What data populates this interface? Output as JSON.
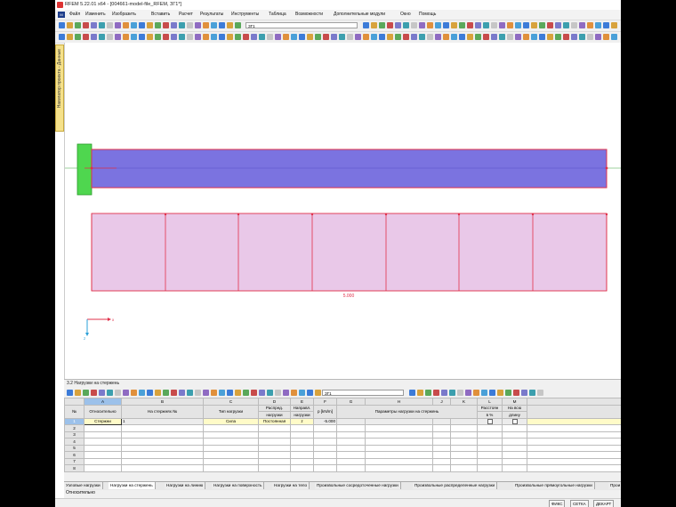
{
  "window": {
    "title": "RFEM 5.22.01 x64 - [004661-model-file_RFEM, ЗГ1*]"
  },
  "menu": [
    "Файл",
    "Изменить",
    "Изобразить",
    "Вставить",
    "Расчет",
    "Результаты",
    "Инструменты",
    "Таблица",
    "Возможности",
    "Дополнительные модули",
    "Окно",
    "Помощь"
  ],
  "toolbar": {
    "load_case_combo": "ЗГ1"
  },
  "navigator": {
    "tab_label": "Навигатор проекта - Данные"
  },
  "viewport": {
    "load_label": "5.000",
    "axis_x": "x",
    "axis_z": "z"
  },
  "panel": {
    "title": "3.2 Нагрузки на стержень",
    "combo": "ЗГ1",
    "col_letters": [
      "",
      "A",
      "B",
      "C",
      "D",
      "E",
      "F",
      "G",
      "H",
      "I",
      "J",
      "K",
      "L",
      "M",
      ""
    ],
    "headers": {
      "num": "№",
      "relative": "Относительно",
      "members": "На стержнях №",
      "load_type": "Тип нагрузки",
      "distribution_1": "Распред.",
      "distribution_2": "нагрузки",
      "direction_1": "Направл.",
      "direction_2": "нагрузки",
      "p": "p [kN/m]",
      "params": "Параметры нагрузки на стержень",
      "distance_1": "Расстоян",
      "distance_2": "в %",
      "over_length_1": "На всю",
      "over_length_2": "длину"
    },
    "rows": [
      {
        "num": "1",
        "relative": "Стержни",
        "members": "1",
        "load_type": "Сила",
        "distribution": "Постоянная",
        "direction": "z",
        "p": "-5.000"
      },
      {
        "num": "2"
      },
      {
        "num": "3"
      },
      {
        "num": "4"
      },
      {
        "num": "5"
      },
      {
        "num": "6"
      },
      {
        "num": "7"
      },
      {
        "num": "8"
      }
    ],
    "tabs": [
      "Узловые нагрузки",
      "Нагрузки на стержень",
      "Нагрузки на линию",
      "Нагрузки на поверхность",
      "Нагрузки на тело",
      "Произвольные сосредоточенные нагрузки",
      "Произвольные распределенные нагрузки",
      "Произвольные прямоугольные нагрузки",
      "Прои"
    ],
    "status_text": "Относительно"
  },
  "statusbar": [
    "ФИКС",
    "СЕТКА",
    "ДЕКАРТ"
  ],
  "colors": {
    "member_fill": "#7b73e0",
    "member_edge": "#e0304a",
    "load_fill": "#e9c8e8",
    "load_edge": "#e0304a",
    "support": "#4fd64f",
    "selection": "#9cc1ea"
  }
}
